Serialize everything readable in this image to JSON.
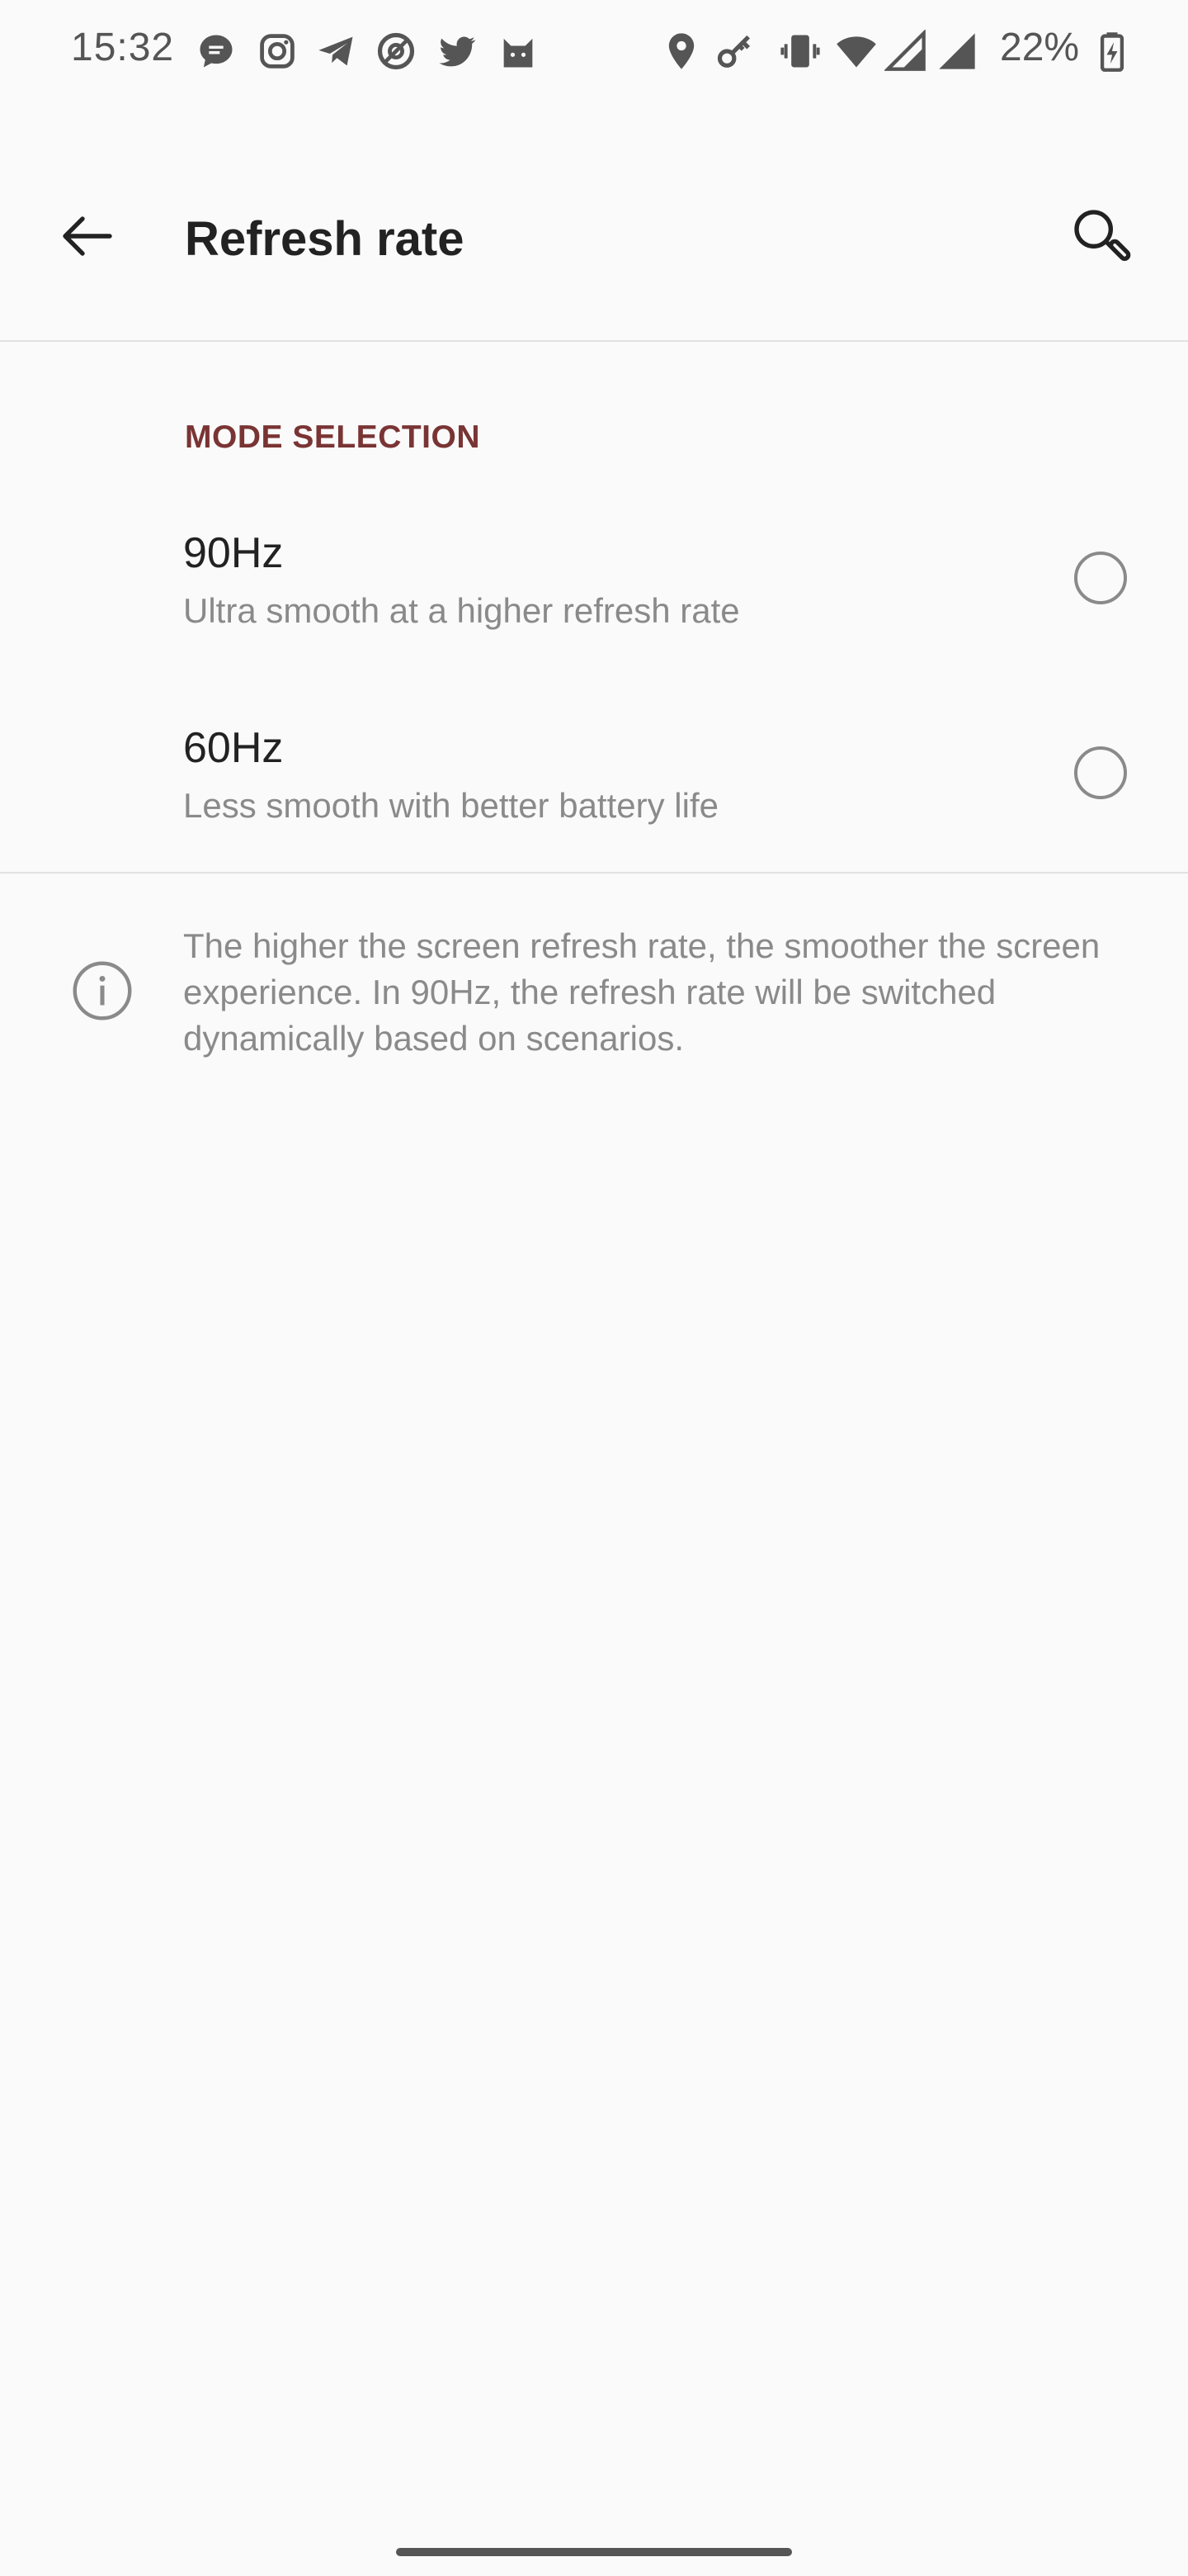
{
  "status_bar": {
    "time": "15:32",
    "battery": "22%",
    "notification_icons": [
      "chat-bubble-icon",
      "instagram-icon",
      "telegram-icon",
      "at-sign-icon",
      "twitter-icon",
      "cat-icon"
    ],
    "system_icons": [
      "location-icon",
      "key-icon",
      "vibrate-icon",
      "wifi-icon",
      "signal-icon",
      "signal-icon",
      "battery-icon"
    ]
  },
  "toolbar": {
    "title": "Refresh rate",
    "back_icon": "arrow-back-icon",
    "search_icon": "search-icon"
  },
  "section": {
    "header": "MODE SELECTION"
  },
  "options": [
    {
      "title": "90Hz",
      "subtitle": "Ultra smooth at a higher refresh rate",
      "selected": false
    },
    {
      "title": "60Hz",
      "subtitle": "Less smooth with better battery life",
      "selected": false
    }
  ],
  "info": {
    "icon": "info-icon",
    "text": "The higher the screen refresh rate, the smoother the screen experience. In 90Hz, the refresh rate will be switched dynamically based on scenarios."
  },
  "colors": {
    "accent": "#7a3434",
    "background": "#fafafa",
    "primary_text": "#222222",
    "secondary_text": "#8a8a8a"
  }
}
